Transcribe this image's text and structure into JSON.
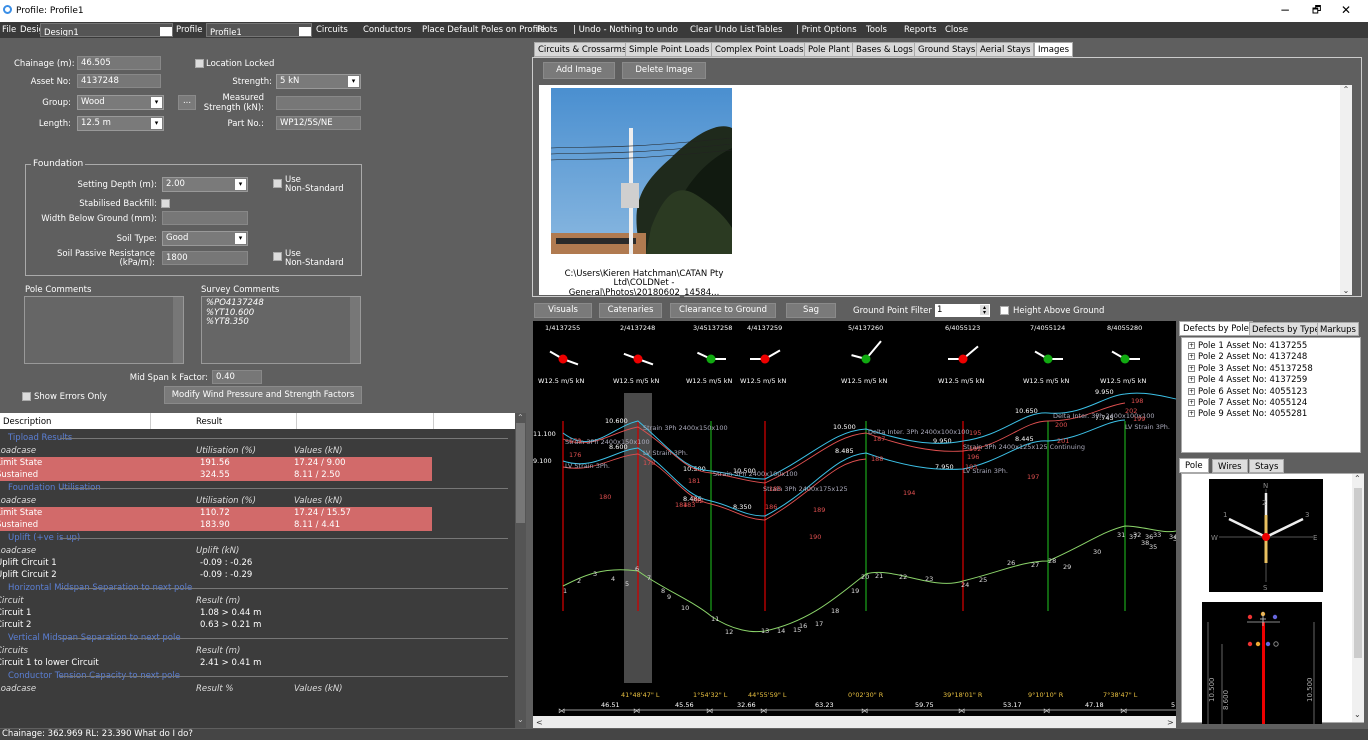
{
  "window": {
    "title": "Profile: Profile1",
    "minimize": "−",
    "restore": "🗗",
    "close": "✕"
  },
  "menu": {
    "file": "File",
    "design": "Design",
    "design_value": "Design1",
    "profile": "Profile",
    "profile_value": "Profile1",
    "circuits": "Circuits",
    "conductors": "Conductors",
    "place_default": "Place Default Poles on Profile",
    "plots": "Plots",
    "undo": "| Undo - Nothing to undo",
    "clear_undo": "Clear Undo List",
    "tables": "Tables",
    "print_options": "| Print Options",
    "tools": "Tools",
    "reports": "Reports",
    "close": "Close"
  },
  "pole_form": {
    "chainage_label": "Chainage (m):",
    "chainage": "46.505",
    "location_locked": "Location Locked",
    "asset_label": "Asset No:",
    "asset": "4137248",
    "strength_label": "Strength:",
    "strength": "5 kN",
    "group_label": "Group:",
    "group": "Wood",
    "group_btn": "...",
    "measured_label_1": "Measured",
    "measured_label_2": "Strength (kN):",
    "measured": "",
    "length_label": "Length:",
    "length": "12.5 m",
    "part_label": "Part No.:",
    "part": "WP12/5S/NE"
  },
  "foundation": {
    "title": "Foundation",
    "setting_label": "Setting Depth (m):",
    "setting": "2.00",
    "use_ns_1": "Use",
    "use_ns_2": "Non-Standard",
    "stabilised": "Stabilised Backfill:",
    "width_label": "Width Below Ground (mm):",
    "width": "",
    "soil_label": "Soil Type:",
    "soil": "Good",
    "spr_label_1": "Soil Passive Resistance",
    "spr_label_2": "(kPa/m):",
    "spr": "1800"
  },
  "comments": {
    "pole_label": "Pole Comments",
    "pole_text": "",
    "survey_label": "Survey Comments",
    "survey_lines": [
      "%PO4137248",
      "%YT10.600",
      "%YT8.350"
    ]
  },
  "midspan": {
    "label": "Mid Span k Factor:",
    "value": "0.40"
  },
  "show_errors": "Show Errors Only",
  "modify_btn": "Modify Wind Pressure and Strength Factors",
  "results": {
    "col_description": "Description",
    "col_result": "Result",
    "sections": [
      {
        "title": "Tipload Results",
        "header": [
          "Loadcase",
          "Utilisation (%)",
          "Values (kN)"
        ],
        "rows": [
          {
            "c": [
              "Limit State",
              "191.56",
              "17.24 / 9.00"
            ],
            "red": true
          },
          {
            "c": [
              "Sustained",
              "324.55",
              "8.11 / 2.50"
            ],
            "red": true
          }
        ]
      },
      {
        "title": "Foundation Utilisation",
        "header": [
          "Loadcase",
          "Utilisation (%)",
          "Values (kN)"
        ],
        "rows": [
          {
            "c": [
              "Limit State",
              "110.72",
              "17.24 / 15.57"
            ],
            "red": true
          },
          {
            "c": [
              "Sustained",
              "183.90",
              "8.11 / 4.41"
            ],
            "red": true
          }
        ]
      },
      {
        "title": "Uplift (+ve is up)",
        "header": [
          "Loadcase",
          "Uplift (kN)",
          ""
        ],
        "rows": [
          {
            "c": [
              "Uplift Circuit 1",
              "-0.09 : -0.26",
              ""
            ],
            "red": false
          },
          {
            "c": [
              "Uplift Circuit 2",
              "-0.09 : -0.29",
              ""
            ],
            "red": false
          }
        ]
      },
      {
        "title": "Horizontal Midspan Separation to next pole",
        "header": [
          "Circuit",
          "Result (m)",
          ""
        ],
        "rows": [
          {
            "c": [
              "Circuit 1",
              "1.08 > 0.44 m",
              ""
            ],
            "red": false
          },
          {
            "c": [
              "Circuit 2",
              "0.63 > 0.21 m",
              ""
            ],
            "red": false
          }
        ]
      },
      {
        "title": "Vertical Midspan Separation to next pole",
        "header": [
          "Circuits",
          "Result (m)",
          ""
        ],
        "rows": [
          {
            "c": [
              "Circuit 1 to lower Circuit",
              "2.41 > 0.41 m",
              ""
            ],
            "red": false
          }
        ]
      },
      {
        "title": "Conductor Tension Capacity to next pole",
        "header": [
          "Loadcase",
          "Result %",
          "Values (kN)"
        ],
        "rows": []
      }
    ]
  },
  "status": "Chainage: 362.969 RL: 23.390   What do I do?",
  "tabs": [
    "Circuits & Crossarms",
    "Simple Point Loads",
    "Complex Point Loads",
    "Pole Plant",
    "Bases & Logs",
    "Ground Stays",
    "Aerial Stays",
    "Images"
  ],
  "images": {
    "add": "Add Image",
    "delete": "Delete Image",
    "caption_1": "C:\\Users\\Kieren Hatchman\\CATAN Pty",
    "caption_2": "Ltd\\COLDNet - General\\Photos\\20180602_14584..."
  },
  "profile_toolbar": {
    "visuals": "Visuals",
    "catenaries": "Catenaries",
    "clearance": "Clearance to Ground",
    "sag": "Sag",
    "filter_label": "Ground Point Filter",
    "filter_value": "1",
    "height_above": "Height Above Ground"
  },
  "profile": {
    "poles": [
      {
        "id": "1/4137255",
        "rating": "W12.5 m/5 kN",
        "color": "#e00"
      },
      {
        "id": "2/4137248",
        "rating": "W12.5 m/5 kN",
        "color": "#e00"
      },
      {
        "id": "3/45137258",
        "rating": "W12.5 m/5 kN",
        "color": "#1a1"
      },
      {
        "id": "4/4137259",
        "rating": "W12.5 m/5 kN",
        "color": "#e00"
      },
      {
        "id": "5/4137260",
        "rating": "W12.5 m/5 kN",
        "color": "#1a1"
      },
      {
        "id": "6/4055123",
        "rating": "W12.5 m/5 kN",
        "color": "#e00"
      },
      {
        "id": "7/4055124",
        "rating": "W12.5 m/5 kN",
        "color": "#1a1"
      },
      {
        "id": "8/4055280",
        "rating": "W12.5 m/5 kN",
        "color": "#1a1"
      }
    ],
    "heights": [
      "11.100",
      "9.100",
      "10.600",
      "8.600",
      "10.500",
      "8.485",
      "10.500",
      "8.350",
      "10.500",
      "8.485",
      "9.950",
      "7.950",
      "10.650",
      "8.445",
      "9.950",
      "7.745"
    ],
    "wire_labels": [
      "Strain 3Ph 2400x150x100",
      "LV Strain 3Ph.",
      "Strain 3Ph 2400x150x100",
      "LV Strain 3Ph.",
      "Strain 3Ph 2400x100x100",
      "Strain 3Ph 2400x175x125",
      "Delta Inter. 3Ph 2400x100x100",
      "Strain 3Ph 2400x125x125 Continuing",
      "LV Strain 3Ph.",
      "Delta Inter. 3Ph 2400x100x100",
      "LV Strain 3Ph."
    ],
    "ground_points": [
      "1",
      "2",
      "3",
      "4",
      "5",
      "6",
      "7",
      "8",
      "9",
      "10",
      "11",
      "12",
      "13",
      "14",
      "15",
      "16",
      "17",
      "18",
      "19",
      "20",
      "21",
      "22",
      "23",
      "24",
      "25",
      "26",
      "27",
      "28",
      "29",
      "30",
      "31",
      "32",
      "33",
      "34",
      "35",
      "36",
      "37",
      "38",
      "39"
    ],
    "red_numbers": [
      "179",
      "176",
      "180",
      "178",
      "181",
      "182",
      "183",
      "184",
      "185",
      "186",
      "189",
      "190",
      "187",
      "188",
      "192",
      "193",
      "194",
      "195",
      "196",
      "197",
      "198",
      "199",
      "200",
      "201",
      "202"
    ],
    "angles": [
      "41°48'47\" L",
      "1°54'32\" L",
      "44°55'59\" L",
      "0°02'30\" R",
      "39°18'01\" R",
      "9°10'10\" R",
      "7°38'47\" L"
    ],
    "spans": [
      "46.51",
      "45.56",
      "32.66",
      "63.23",
      "59.75",
      "53.17",
      "47.18",
      "5"
    ]
  },
  "defects_tabs": [
    "Defects by Pole",
    "Defects by Type",
    "Markups"
  ],
  "defects": [
    "Pole 1 Asset No: 4137255",
    "Pole 2 Asset No: 4137248",
    "Pole 3 Asset No: 45137258",
    "Pole 4 Asset No: 4137259",
    "Pole 6 Asset No: 4055123",
    "Pole 7 Asset No: 4055124",
    "Pole 9 Asset No: 4055281"
  ],
  "pole_tabs": [
    "Pole",
    "Wires",
    "Stays"
  ],
  "compass": {
    "n": "N",
    "s": "S",
    "e": "E",
    "w": "W",
    "l1": "1",
    "l2": "2",
    "l3": "3"
  },
  "elevation": {
    "left": "10.500",
    "left2": "8.600",
    "right": "10.500"
  },
  "colors": {
    "red": "#d26a6a",
    "section": "#5b7fd4",
    "pole_red": "#e00000",
    "pole_green": "#1aa01a",
    "catenary_blue": "#3cc0e6",
    "ground": "#8bd46a"
  }
}
